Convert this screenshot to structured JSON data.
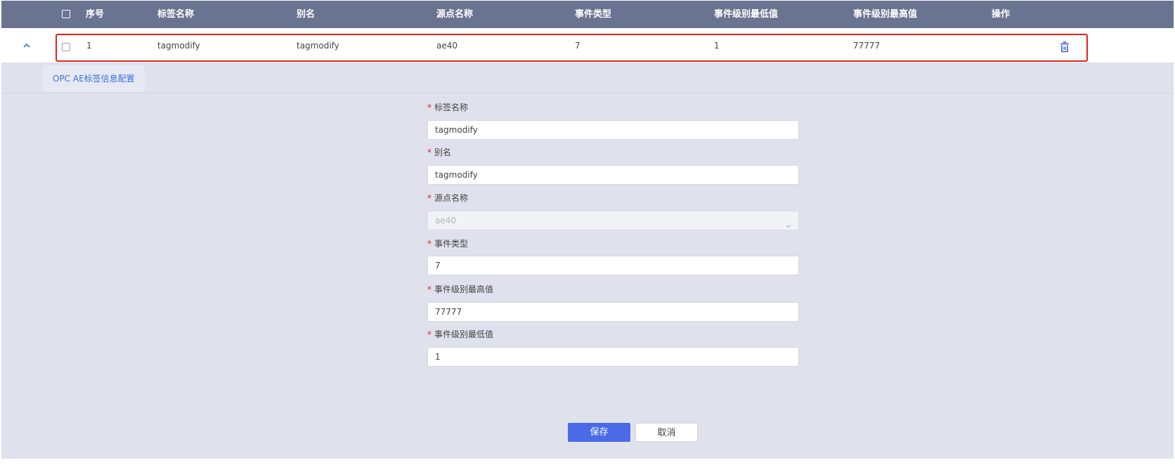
{
  "table": {
    "headers": {
      "index": "序号",
      "tag_name": "标签名称",
      "alias": "别名",
      "source_name": "源点名称",
      "event_type": "事件类型",
      "level_min": "事件级别最低值",
      "level_max": "事件级别最高值",
      "actions": "操作"
    },
    "row": {
      "index": "1",
      "tag_name": "tagmodify",
      "alias": "tagmodify",
      "source_name": "ae40",
      "event_type": "7",
      "level_min": "1",
      "level_max": "77777"
    }
  },
  "panel": {
    "tab_label": "OPC AE标签信息配置",
    "fields": {
      "tag_name": {
        "label": "标签名称",
        "value": "tagmodify"
      },
      "alias": {
        "label": "别名",
        "value": "tagmodify"
      },
      "source_name": {
        "label": "源点名称",
        "value": "ae40"
      },
      "event_type": {
        "label": "事件类型",
        "value": "7"
      },
      "level_max": {
        "label": "事件级别最高值",
        "value": "77777"
      },
      "level_min": {
        "label": "事件级别最低值",
        "value": "1"
      }
    },
    "required_mark": "*",
    "save_label": "保存",
    "cancel_label": "取消"
  },
  "icons": {
    "expand": "chevron-up-icon",
    "delete": "trash-icon",
    "select_arrow": "chevron-down-icon"
  },
  "colors": {
    "header_bg": "#6a7390",
    "panel_bg": "#dfe1ec",
    "accent": "#4a6ae8",
    "highlight_border": "#e2231a",
    "required": "#e2231a"
  }
}
